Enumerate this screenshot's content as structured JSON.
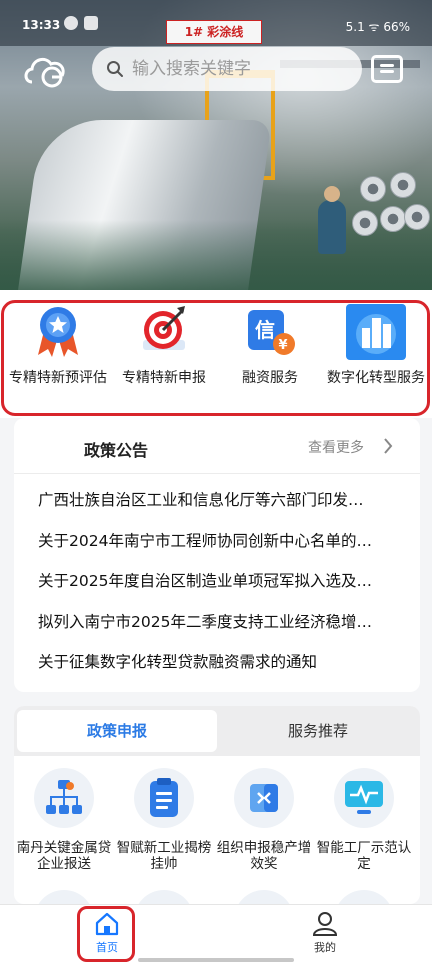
{
  "status_bar": {
    "time": "13:33",
    "right": "5.1 ᯤ 66%"
  },
  "hero": {
    "sign_text": "1# 彩涂线"
  },
  "search": {
    "placeholder": "输入搜索关键字"
  },
  "quick_services": [
    {
      "label": "专精特新预评估",
      "icon": "medal-icon"
    },
    {
      "label": "专精特新申报",
      "icon": "target-icon"
    },
    {
      "label": "融资服务",
      "icon": "credit-finance-icon"
    },
    {
      "label": "数字化转型服务",
      "icon": "city-digital-icon"
    }
  ],
  "news": {
    "title": "政策公告",
    "more": "查看更多",
    "items": [
      "广西壮族自治区工业和信息化厅等六部门印发…",
      "关于2024年南宁市工程师协同创新中心名单的…",
      "关于2025年度自治区制造业单项冠军拟入选及…",
      "拟列入南宁市2025年二季度支持工业经济稳增…",
      "关于征集数字化转型贷款融资需求的通知"
    ]
  },
  "policy_tabs": {
    "active": "政策申报",
    "inactive": "服务推荐",
    "items": [
      {
        "label": "南丹关键金属贷企业报送",
        "icon": "org-chart-icon"
      },
      {
        "label": "智赋新工业揭榜挂帅",
        "icon": "clipboard-icon"
      },
      {
        "label": "组织申报稳产增效奖",
        "icon": "split-panel-icon"
      },
      {
        "label": "智能工厂示范认定",
        "icon": "monitor-pulse-icon"
      }
    ]
  },
  "bottom_nav": {
    "home": "首页",
    "mine": "我的"
  },
  "colors": {
    "accent": "#2c7be5",
    "highlight_frame": "#d8252b",
    "nav_home": "#1677ff"
  }
}
